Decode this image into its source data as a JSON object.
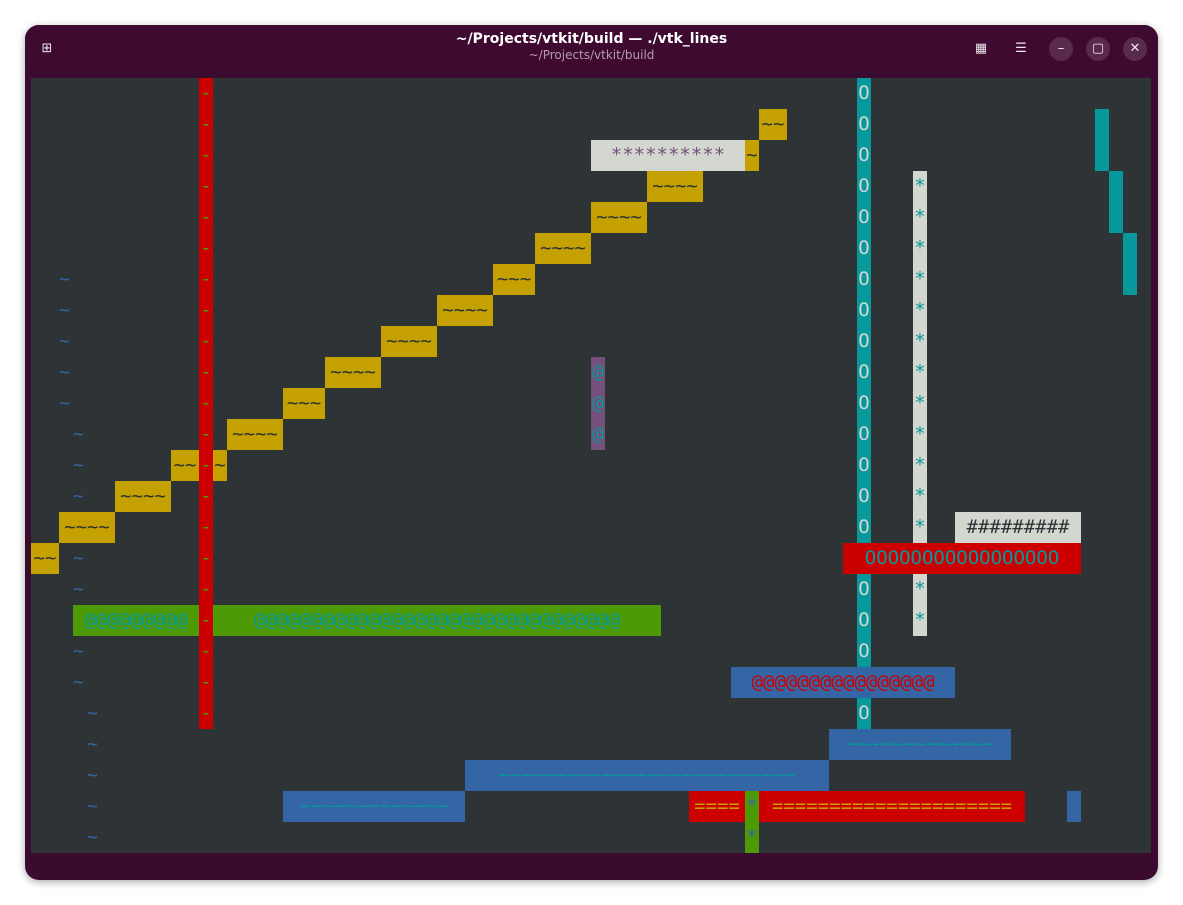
{
  "window": {
    "title": "~/Projects/vtkit/build — ./vtk_lines",
    "subtitle": "~/Projects/vtkit/build",
    "buttons": {
      "new_tab": "⊞",
      "view": "▦",
      "menu": "☰",
      "minimize": "–",
      "maximize": "▢",
      "close": "✕"
    }
  },
  "colors": {
    "terminal_bg": "#2e3436",
    "yellow": "#c4a000",
    "red": "#cc0000",
    "green": "#4e9a06",
    "blue": "#3465a4",
    "cyan": "#06989a",
    "magenta": "#75507b",
    "white": "#d3d7cf"
  },
  "terminal": {
    "cells": [
      {
        "id": "red-bar-dashes",
        "text": "-",
        "fg": "#4e9a06",
        "bg": "#cc0000"
      },
      {
        "id": "yellow-tilde",
        "text": "~~",
        "fg": "#2e3436",
        "bg": "#c4a000"
      },
      {
        "id": "white-stars-top",
        "text": "**********",
        "fg": "#75507b",
        "bg": "#d3d7cf"
      },
      {
        "id": "yellow-tilde-single",
        "text": "~",
        "fg": "#2e3436",
        "bg": "#c4a000"
      },
      {
        "id": "yellow-tilde-4",
        "text": "~~~~",
        "fg": "#2e3436",
        "bg": "#c4a000"
      },
      {
        "id": "yellow-tilde-3",
        "text": "~~~",
        "fg": "#2e3436",
        "bg": "#c4a000"
      },
      {
        "id": "magenta-at",
        "text": "@",
        "fg": "#06989a",
        "bg": "#75507b"
      },
      {
        "id": "cyan-o",
        "text": "O",
        "fg": "#d3d7cf",
        "bg": "#06989a"
      },
      {
        "id": "white-star",
        "text": "*",
        "fg": "#06989a",
        "bg": "#d3d7cf"
      },
      {
        "id": "white-hashes",
        "text": "#########",
        "fg": "#2e3436",
        "bg": "#d3d7cf"
      },
      {
        "id": "red-o-row",
        "text": "OOOOOOOOOOOOOOOOO",
        "fg": "#06989a",
        "bg": "#cc0000"
      },
      {
        "id": "green-at-left",
        "text": "@@@@@@@@@",
        "fg": "#06989a",
        "bg": "#4e9a06"
      },
      {
        "id": "green-at-right",
        "text": "@@@@@@@@@@@@@@@@@@@@@@@@@@@@@@@@",
        "fg": "#06989a",
        "bg": "#4e9a06"
      },
      {
        "id": "blue-at-row",
        "text": "@@@@@@@@@@@@@@@@",
        "fg": "#cc0000",
        "bg": "#3465a4"
      },
      {
        "id": "blue-tilde-a",
        "text": "~~~~~~~~~~~~~",
        "fg": "#06989a",
        "bg": "#3465a4"
      },
      {
        "id": "blue-tilde-b",
        "text": "~~~~~~~~~~~~~~~~~~~~~~~~~~",
        "fg": "#06989a",
        "bg": "#3465a4"
      },
      {
        "id": "blue-tilde-c",
        "text": "~~~~~~~~~~~~~",
        "fg": "#06989a",
        "bg": "#3465a4"
      },
      {
        "id": "red-eq-left",
        "text": "====",
        "fg": "#c4a000",
        "bg": "#cc0000"
      },
      {
        "id": "red-eq-right",
        "text": "=====================",
        "fg": "#c4a000",
        "bg": "#cc0000"
      },
      {
        "id": "green-star",
        "text": "*",
        "fg": "#3465a4",
        "bg": "#4e9a06"
      },
      {
        "id": "blue-tilde-fg",
        "text": "~",
        "fg": "#3465a4",
        "bg": ""
      }
    ]
  }
}
